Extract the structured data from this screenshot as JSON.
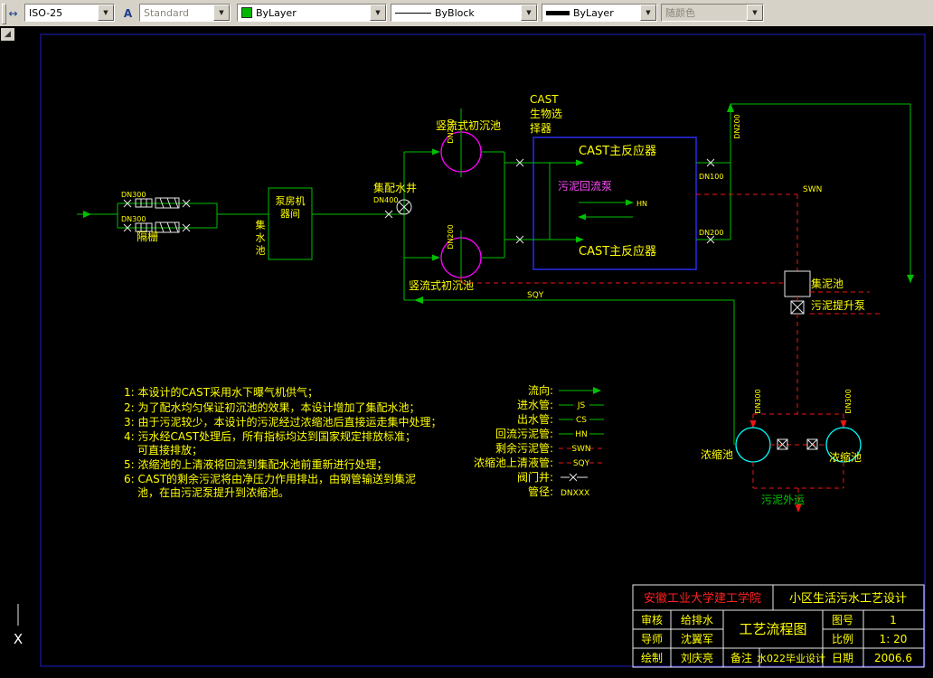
{
  "toolbar": {
    "dim_style": "ISO-25",
    "text_style": "Standard",
    "color": "ByLayer",
    "linetype": "ByBlock",
    "lineweight": "ByLayer",
    "plot_style": "随颜色"
  },
  "ucs": {
    "x_label": "X"
  },
  "diagram": {
    "labels": {
      "bar_screen": "隔栅",
      "pump_house_1": "泵房机",
      "pump_house_2": "器间",
      "collection_tank": "集水池",
      "dist_well": "集配水井",
      "primary_top": "竖流式初沉池",
      "primary_bottom": "竖流式初沉池",
      "cast_1": "CAST",
      "cast_2": "生物选",
      "cast_3": "择器",
      "reactor_top": "CAST主反应器",
      "reactor_bottom": "CAST主反应器",
      "return_pump": "污泥回流泵",
      "hn_tag": "HN",
      "swn_tag": "SWN",
      "sqy_tag": "SQY",
      "sludge_tank": "集泥池",
      "sludge_pump": "污泥提升泵",
      "thickener_left": "浓缩池",
      "thickener_right": "浓缩池",
      "sludge_out": "污泥外运"
    },
    "pipe_sizes": {
      "screen_top": "DN300",
      "screen_bottom": "DN300",
      "well": "DN400",
      "primary_top": "DN200",
      "primary_bottom": "DN200",
      "reactor_out_top": "DN100",
      "reactor_out_bottom": "DN200",
      "effluent": "DN200",
      "thick_left": "DN300",
      "thick_right": "DN300"
    }
  },
  "notes": [
    "1: 本设计的CAST采用水下曝气机供气；",
    "2: 为了配水均匀保证初沉池的效果，本设计增加了集配水池；",
    "3: 由于污泥较少，本设计的污泥经过浓缩池后直接运走集中处理；",
    "4: 污水经CAST处理后，所有指标均达到国家规定排放标准；",
    "可直接排放；",
    "5: 浓缩池的上清液将回流到集配水池前重新进行处理；",
    "6: CAST的剩余污泥将由净压力作用排出，由钢管输送到集泥",
    "池，在由污泥泵提升到浓缩池。"
  ],
  "legend": {
    "items": [
      {
        "label": "流向:",
        "code": ""
      },
      {
        "label": "进水管:",
        "code": "JS"
      },
      {
        "label": "出水管:",
        "code": "CS"
      },
      {
        "label": "回流污泥管:",
        "code": "HN"
      },
      {
        "label": "剩余污泥管:",
        "code": "SWN"
      },
      {
        "label": "浓缩池上清液管:",
        "code": "SQY"
      },
      {
        "label": "阀门井:",
        "code": ""
      },
      {
        "label": "管径:",
        "code": "DNXXX"
      }
    ]
  },
  "title_block": {
    "university": "安徽工业大学建工学院",
    "project": "小区生活污水工艺设计",
    "review_label": "审核",
    "discipline": "给排水",
    "drawing_title": "工艺流程图",
    "sheet_label": "图号",
    "sheet_no": "1",
    "advisor_label": "导师",
    "advisor": "沈翼军",
    "scale_label": "比例",
    "scale": "1: 20",
    "draft_label": "绘制",
    "drafter": "刘庆亮",
    "remark_label": "备注",
    "remark": "水022毕业设计",
    "date_label": "日期",
    "date": "2006.6"
  }
}
